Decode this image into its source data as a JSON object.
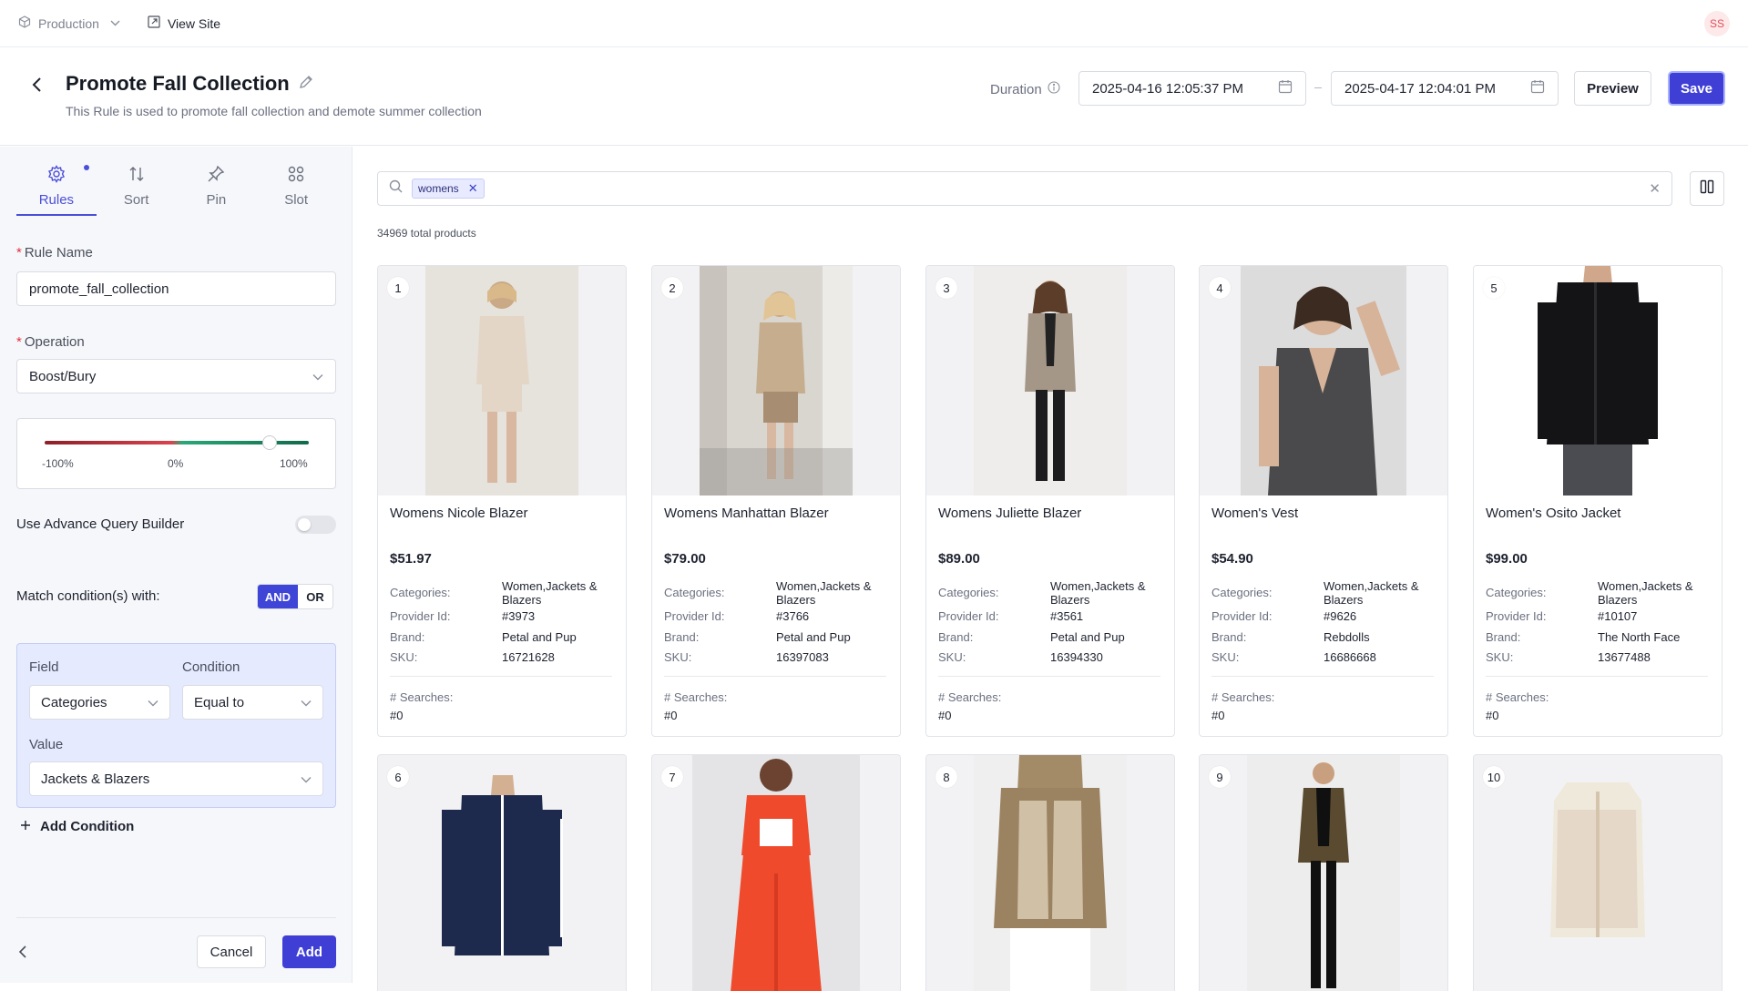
{
  "topbar": {
    "environment": "Production",
    "view_site": "View Site",
    "avatar_initials": "SS"
  },
  "header": {
    "title": "Promote Fall Collection",
    "subtitle": "This Rule is used to promote fall collection and demote summer collection",
    "duration_label": "Duration",
    "start_date": "2025-04-16 12:05:37 PM",
    "end_date": "2025-04-17 12:04:01 PM",
    "preview_label": "Preview",
    "save_label": "Save"
  },
  "left_panel": {
    "tabs": [
      {
        "label": "Rules",
        "icon": "gear-icon",
        "active": true
      },
      {
        "label": "Sort",
        "icon": "sort-icon",
        "active": false
      },
      {
        "label": "Pin",
        "icon": "pin-icon",
        "active": false
      },
      {
        "label": "Slot",
        "icon": "grid-icon",
        "active": false
      }
    ],
    "rule_name_label": "Rule Name",
    "rule_name_value": "promote_fall_collection",
    "operation_label": "Operation",
    "operation_value": "Boost/Bury",
    "slider": {
      "min_label": "-100%",
      "mid_label": "0%",
      "max_label": "100%",
      "value_percent": 70
    },
    "advance_query_label": "Use Advance Query Builder",
    "advance_query_on": false,
    "match_label": "Match condition(s) with:",
    "match_and": "AND",
    "match_or": "OR",
    "condition": {
      "field_label": "Field",
      "field_value": "Categories",
      "condition_label": "Condition",
      "condition_value": "Equal to",
      "value_label": "Value",
      "value_value": "Jackets & Blazers"
    },
    "add_condition_label": "Add Condition",
    "cancel_label": "Cancel",
    "add_label": "Add"
  },
  "main": {
    "search_chip": "womens",
    "total_products": "34969 total products",
    "field_labels": {
      "categories": "Categories:",
      "provider_id": "Provider Id:",
      "brand": "Brand:",
      "sku": "SKU:",
      "searches": "# Searches:"
    },
    "products": [
      {
        "rank": "1",
        "name": "Womens Nicole Blazer",
        "price": "$51.97",
        "categories_1": "Women,Jackets &",
        "categories_2": "Blazers",
        "provider_id": "#3973",
        "brand": "Petal and Pup",
        "sku": "16721628",
        "searches": "#0"
      },
      {
        "rank": "2",
        "name": "Womens Manhattan Blazer",
        "price": "$79.00",
        "categories_1": "Women,Jackets &",
        "categories_2": "Blazers",
        "provider_id": "#3766",
        "brand": "Petal and Pup",
        "sku": "16397083",
        "searches": "#0"
      },
      {
        "rank": "3",
        "name": "Womens Juliette Blazer",
        "price": "$89.00",
        "categories_1": "Women,Jackets &",
        "categories_2": "Blazers",
        "provider_id": "#3561",
        "brand": "Petal and Pup",
        "sku": "16394330",
        "searches": "#0"
      },
      {
        "rank": "4",
        "name": "Women's Vest",
        "price": "$54.90",
        "categories_1": "Women,Jackets &",
        "categories_2": "Blazers",
        "provider_id": "#9626",
        "brand": "Rebdolls",
        "sku": "16686668",
        "searches": "#0"
      },
      {
        "rank": "5",
        "name": "Women's Osito Jacket",
        "price": "$99.00",
        "categories_1": "Women,Jackets &",
        "categories_2": "Blazers",
        "provider_id": "#10107",
        "brand": "The North Face",
        "sku": "13677488",
        "searches": "#0"
      }
    ],
    "products_row2": [
      {
        "rank": "6"
      },
      {
        "rank": "7"
      },
      {
        "rank": "8"
      },
      {
        "rank": "9"
      },
      {
        "rank": "10"
      }
    ]
  }
}
